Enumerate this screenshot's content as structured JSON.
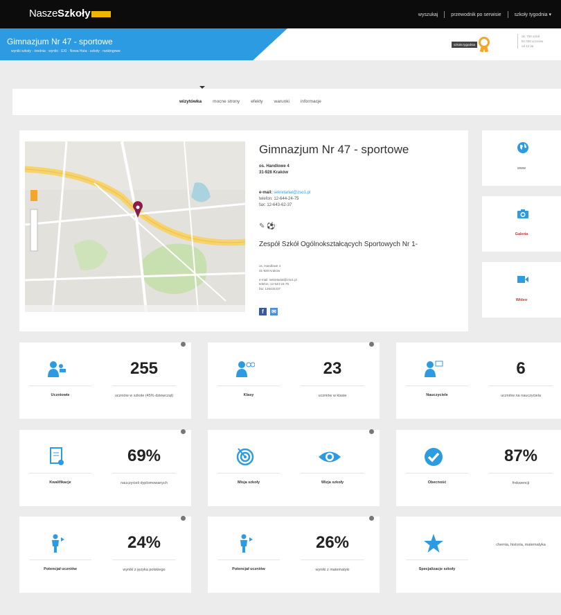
{
  "header": {
    "logo_light": "Nasze",
    "logo_bold": "Szkoły",
    "logo_tag": "",
    "nav": [
      "wyszukaj",
      "przewodnik po serwisie",
      "szkoły tygodnia ▾"
    ]
  },
  "school_bar": {
    "title": "Gimnazjum Nr 47 - sportowe",
    "subtitle": "wyniki szkoły · średnia · wyniki · EXI · Nowa Huta · szkoły · rankingowe",
    "award_label": "szkoła tygodnia",
    "award_info": [
      "ok. 750 szkół",
      "51 000 uczniów",
      "od 12 lat"
    ]
  },
  "tabs": [
    "wizytówka",
    "mocne strony",
    "efekty",
    "warunki",
    "informacje"
  ],
  "active_tab": 0,
  "school": {
    "name": "Gimnazjum Nr 47 - sportowe",
    "address_1": "os. Handlowe 4",
    "address_2": "31-928 Kraków",
    "email_label": "e-mail:",
    "email": "sekretariat@zso1.pl",
    "phone": "telefon: 12-644-24-75",
    "fax": "fax: 12-643-62-37",
    "icons": "✎ ⚽",
    "group_name": "Zespół Szkół Ogólnokształcących Sportowych Nr 1-",
    "group_details": [
      "os. Handlowe 4",
      "31-928 Kraków",
      "",
      "e-mail: sekretariat@zso1.pl",
      "telefon: 12-644-24-75",
      "fax: 126432437"
    ],
    "map_footer": "Dane do mapy ©2014 Google"
  },
  "side": {
    "www": "www",
    "gallery": "Galeria",
    "video": "Wideo"
  },
  "stats": {
    "uczniowie": {
      "label": "Uczniowie",
      "value": "255",
      "desc": "uczniów w szkole (45% dziewcząt)"
    },
    "klasy": {
      "label": "Klasy",
      "value": "23",
      "desc": "uczniów w klasie"
    },
    "nauczyciele": {
      "label": "Nauczyciele",
      "value": "6",
      "desc": "uczniów na nauczyciela"
    },
    "kwalifikacje": {
      "label": "Kwalifikacje",
      "value": "69%",
      "desc": "nauczycieli dyplomowanych"
    },
    "misja": {
      "label": "Misja szkoły",
      "label2": "Wizja szkoły"
    },
    "obecnosc": {
      "label": "Obecność",
      "value": "87%",
      "desc": "frekwencji"
    },
    "potencjal1": {
      "label": "Potencjał uczniów",
      "value": "24%",
      "desc": "wyniki z języka polskiego"
    },
    "potencjal2": {
      "label": "Potencjał uczniów",
      "value": "26%",
      "desc": "wyniki z matematyki"
    },
    "specjalizacje": {
      "label": "Specjalizacje szkoły",
      "desc": "chemia, historia, matematyka"
    }
  },
  "colors": {
    "accent": "#2d9be2",
    "gold": "#f4a62a",
    "dark": "#0c0c0c"
  }
}
